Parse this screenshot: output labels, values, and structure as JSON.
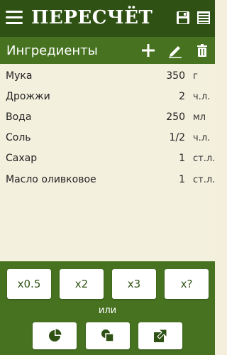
{
  "appbar": {
    "title": "ПЕРЕСЧЁТ",
    "icons": [
      "menu-icon",
      "save-icon",
      "list-icon"
    ]
  },
  "subbar": {
    "title": "Ингредиенты",
    "icons": [
      "plus-icon",
      "pencil-icon",
      "trash-icon"
    ]
  },
  "ingredients": [
    {
      "name": "Мука",
      "qty": "350",
      "unit": "г"
    },
    {
      "name": "Дрожжи",
      "qty": "2",
      "unit": "ч.л."
    },
    {
      "name": "Вода",
      "qty": "250",
      "unit": "мл"
    },
    {
      "name": "Соль",
      "qty": "1/2",
      "unit": "ч.л."
    },
    {
      "name": "Сахар",
      "qty": "1",
      "unit": "ст.л."
    },
    {
      "name": "Масло оливковое",
      "qty": "1",
      "unit": "ст.л."
    }
  ],
  "multipliers": [
    "x0.5",
    "x2",
    "x3",
    "x?"
  ],
  "or_label": "или",
  "bottom_icons": [
    "pie-chart-icon",
    "shapes-icon",
    "export-arrow-icon"
  ],
  "colors": {
    "dark_green": "#2f5214",
    "green": "#477321",
    "background": "#f4f0de"
  }
}
